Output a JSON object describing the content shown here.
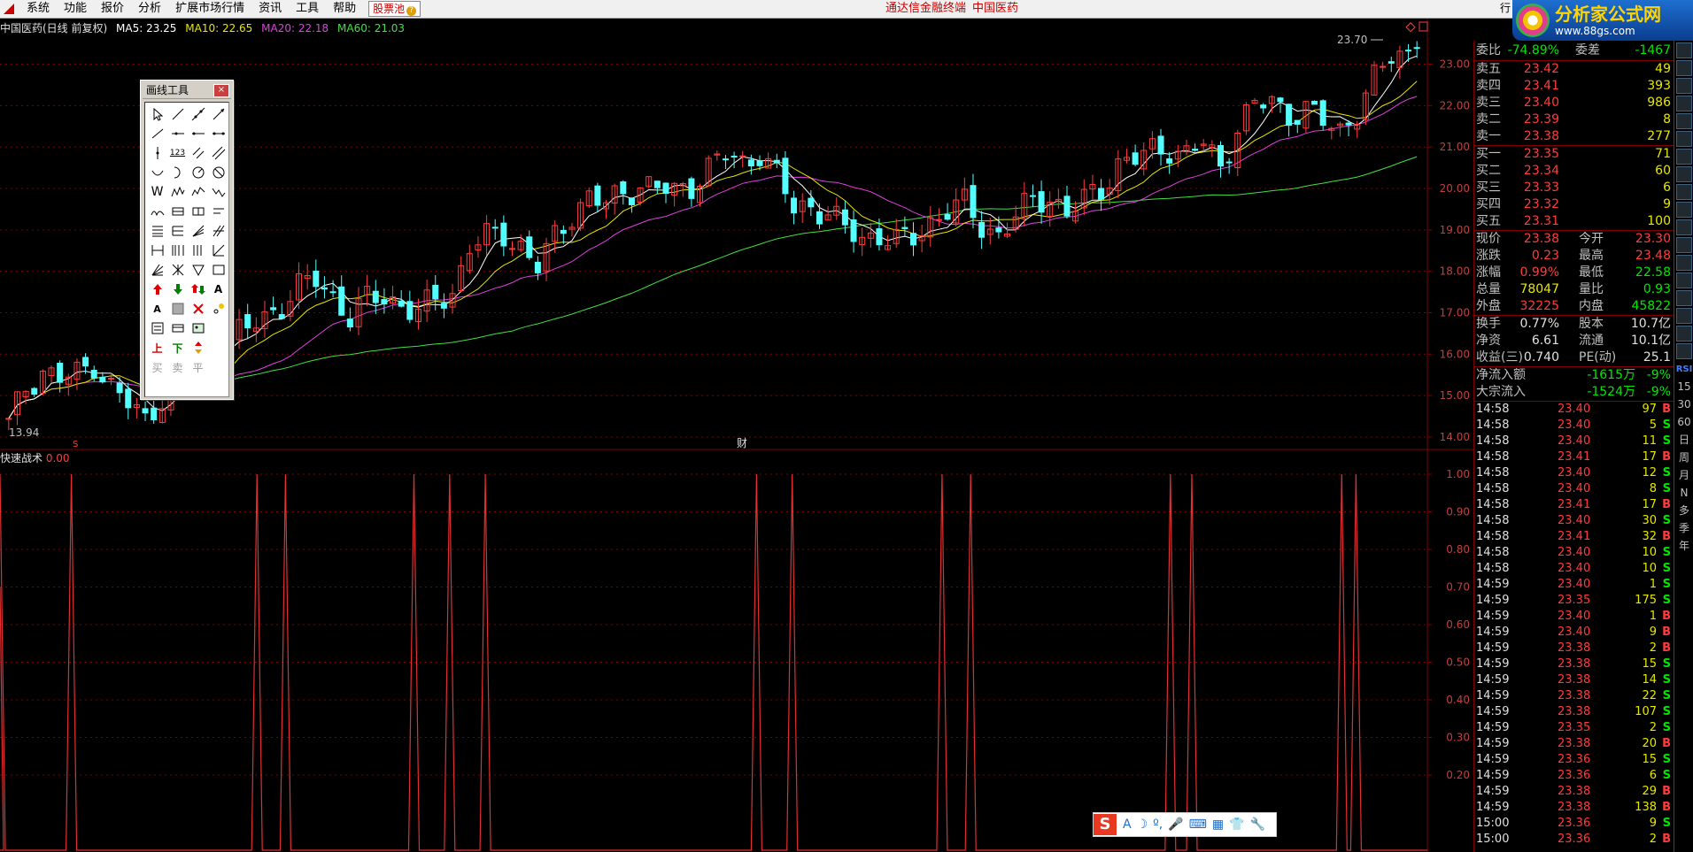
{
  "menu": {
    "items": [
      "系统",
      "功能",
      "报价",
      "分析",
      "扩展市场行情",
      "资讯",
      "工具",
      "帮助"
    ],
    "pool": "股票池",
    "app_title": "通达信金融终端",
    "stock_title": "中国医药"
  },
  "brand": {
    "name": "分析家公式网",
    "url": "www.88gs.com",
    "left_tab": "行"
  },
  "main_chart": {
    "title": "中国医药(日线 前复权)",
    "ma5": "MA5: 23.25",
    "ma10": "MA10: 22.65",
    "ma20": "MA20: 22.18",
    "ma60": "MA60: 21.03",
    "high_label": "23.70",
    "low_label": "13.94",
    "marker_s": "S",
    "marker_cai": "财"
  },
  "indicator": {
    "name": "快速战术",
    "value": "0.00"
  },
  "toolbox": {
    "title": "画线工具",
    "close": "×",
    "text_tools": [
      "123",
      "W",
      "A",
      "A",
      "上",
      "下",
      "买",
      "卖",
      "平"
    ]
  },
  "colors": {
    "up": "#ff3c3c",
    "down": "#54ffff",
    "ma5": "#ffffff",
    "ma10": "#e6e600",
    "ma20": "#e040e0",
    "ma60": "#40e040",
    "grid": "#800000"
  },
  "quote": {
    "weibi": {
      "label": "委比",
      "value": "-74.89%",
      "label2": "委差",
      "value2": "-1467"
    },
    "sell": [
      {
        "label": "卖五",
        "price": "23.42",
        "vol": "49"
      },
      {
        "label": "卖四",
        "price": "23.41",
        "vol": "393"
      },
      {
        "label": "卖三",
        "price": "23.40",
        "vol": "986"
      },
      {
        "label": "卖二",
        "price": "23.39",
        "vol": "8"
      },
      {
        "label": "卖一",
        "price": "23.38",
        "vol": "277"
      }
    ],
    "buy": [
      {
        "label": "买一",
        "price": "23.35",
        "vol": "71"
      },
      {
        "label": "买二",
        "price": "23.34",
        "vol": "60"
      },
      {
        "label": "买三",
        "price": "23.33",
        "vol": "6"
      },
      {
        "label": "买四",
        "price": "23.32",
        "vol": "9"
      },
      {
        "label": "买五",
        "price": "23.31",
        "vol": "100"
      }
    ],
    "stats": [
      {
        "l1": "现价",
        "v1": "23.38",
        "c1": "red",
        "l2": "今开",
        "v2": "23.30",
        "c2": "red"
      },
      {
        "l1": "涨跌",
        "v1": "0.23",
        "c1": "red",
        "l2": "最高",
        "v2": "23.48",
        "c2": "red"
      },
      {
        "l1": "涨幅",
        "v1": "0.99%",
        "c1": "red",
        "l2": "最低",
        "v2": "22.58",
        "c2": "green"
      },
      {
        "l1": "总量",
        "v1": "78047",
        "c1": "yellow",
        "l2": "量比",
        "v2": "0.93",
        "c2": "green"
      },
      {
        "l1": "外盘",
        "v1": "32225",
        "c1": "red",
        "l2": "内盘",
        "v2": "45822",
        "c2": "green"
      }
    ],
    "stats2": [
      {
        "l1": "换手",
        "v1": "0.77%",
        "c1": "white",
        "l2": "股本",
        "v2": "10.7亿",
        "c2": "white"
      },
      {
        "l1": "净资",
        "v1": "6.61",
        "c1": "white",
        "l2": "流通",
        "v2": "10.1亿",
        "c2": "white"
      },
      {
        "l1": "收益(三)",
        "v1": "0.740",
        "c1": "white",
        "l2": "PE(动)",
        "v2": "25.1",
        "c2": "white"
      }
    ],
    "flow": [
      {
        "label": "净流入额",
        "value": "-1615万",
        "pct": "-9%"
      },
      {
        "label": "大宗流入",
        "value": "-1524万",
        "pct": "-9%"
      }
    ],
    "ticks": [
      {
        "t": "14:58",
        "p": "23.40",
        "pc": "red",
        "v": "97",
        "bs": "B"
      },
      {
        "t": "14:58",
        "p": "23.40",
        "pc": "red",
        "v": "5",
        "bs": "S"
      },
      {
        "t": "14:58",
        "p": "23.40",
        "pc": "red",
        "v": "11",
        "bs": "S"
      },
      {
        "t": "14:58",
        "p": "23.41",
        "pc": "red",
        "v": "17",
        "bs": "B"
      },
      {
        "t": "14:58",
        "p": "23.40",
        "pc": "red",
        "v": "12",
        "bs": "S"
      },
      {
        "t": "14:58",
        "p": "23.40",
        "pc": "red",
        "v": "8",
        "bs": "S"
      },
      {
        "t": "14:58",
        "p": "23.41",
        "pc": "red",
        "v": "17",
        "bs": "B"
      },
      {
        "t": "14:58",
        "p": "23.40",
        "pc": "red",
        "v": "30",
        "bs": "S"
      },
      {
        "t": "14:58",
        "p": "23.41",
        "pc": "red",
        "v": "32",
        "bs": "B"
      },
      {
        "t": "14:58",
        "p": "23.40",
        "pc": "red",
        "v": "10",
        "bs": "S"
      },
      {
        "t": "14:58",
        "p": "23.40",
        "pc": "red",
        "v": "10",
        "bs": "S"
      },
      {
        "t": "14:59",
        "p": "23.40",
        "pc": "red",
        "v": "1",
        "bs": "S"
      },
      {
        "t": "14:59",
        "p": "23.35",
        "pc": "red",
        "v": "175",
        "bs": "S"
      },
      {
        "t": "14:59",
        "p": "23.40",
        "pc": "red",
        "v": "1",
        "bs": "B"
      },
      {
        "t": "14:59",
        "p": "23.40",
        "pc": "red",
        "v": "9",
        "bs": "B"
      },
      {
        "t": "14:59",
        "p": "23.38",
        "pc": "red",
        "v": "2",
        "bs": "B"
      },
      {
        "t": "14:59",
        "p": "23.38",
        "pc": "red",
        "v": "15",
        "bs": "S"
      },
      {
        "t": "14:59",
        "p": "23.38",
        "pc": "red",
        "v": "14",
        "bs": "S"
      },
      {
        "t": "14:59",
        "p": "23.38",
        "pc": "red",
        "v": "22",
        "bs": "S"
      },
      {
        "t": "14:59",
        "p": "23.38",
        "pc": "red",
        "v": "107",
        "bs": "S"
      },
      {
        "t": "14:59",
        "p": "23.35",
        "pc": "red",
        "v": "2",
        "bs": "S"
      },
      {
        "t": "14:59",
        "p": "23.38",
        "pc": "red",
        "v": "20",
        "bs": "B"
      },
      {
        "t": "14:59",
        "p": "23.36",
        "pc": "red",
        "v": "15",
        "bs": "S"
      },
      {
        "t": "14:59",
        "p": "23.36",
        "pc": "red",
        "v": "6",
        "bs": "S"
      },
      {
        "t": "14:59",
        "p": "23.38",
        "pc": "red",
        "v": "29",
        "bs": "B"
      },
      {
        "t": "14:59",
        "p": "23.38",
        "pc": "red",
        "v": "138",
        "bs": "B"
      },
      {
        "t": "15:00",
        "p": "23.36",
        "pc": "red",
        "v": "9",
        "bs": "S"
      },
      {
        "t": "15:00",
        "p": "23.36",
        "pc": "red",
        "v": "2",
        "bs": "B"
      }
    ]
  },
  "sidebar": {
    "labels": [
      "RSI",
      "15",
      "30",
      "60",
      "日",
      "周",
      "月",
      "N",
      "多",
      "季",
      "年"
    ]
  },
  "ime": {
    "logo": "S",
    "mode": "A"
  },
  "chart_data": [
    {
      "type": "candlestick",
      "title": "中国医药(日线 前复权)",
      "y_ticks": [
        "23.00",
        "22.00",
        "21.00",
        "20.00",
        "19.00",
        "18.00",
        "17.00",
        "16.00",
        "15.00",
        "14.00"
      ],
      "ylim": [
        13.7,
        24.1
      ],
      "high": 23.7,
      "low": 13.94,
      "ma_last": {
        "MA5": 23.25,
        "MA10": 22.65,
        "MA20": 22.18,
        "MA60": 21.03
      },
      "close_path": [
        14.3,
        15.2,
        15.6,
        15.4,
        15.5,
        15.8,
        15.2,
        14.8,
        14.4,
        15.0,
        15.6,
        15.9,
        16.2,
        16.4,
        16.6,
        16.9,
        17.2,
        17.6,
        17.8,
        17.4,
        16.9,
        17.3,
        17.4,
        17.2,
        17.0,
        17.3,
        17.5,
        18.6,
        18.8,
        18.9,
        18.6,
        18.1,
        18.8,
        19.4,
        19.8,
        19.6,
        19.9,
        20.1,
        20.0,
        19.9,
        20.1,
        20.5,
        20.8,
        20.6,
        20.9,
        20.3,
        19.5,
        19.6,
        19.4,
        19.0,
        18.8,
        18.9,
        18.7,
        18.8,
        19.2,
        19.5,
        19.6,
        19.1,
        18.9,
        19.3,
        19.7,
        19.8,
        19.4,
        19.7,
        20.0,
        20.6,
        20.7,
        20.9,
        21.0,
        20.8,
        21.1,
        20.5,
        21.5,
        22.0,
        22.1,
        21.8,
        21.9,
        21.6,
        21.4,
        21.9,
        22.6,
        23.2,
        23.3
      ]
    },
    {
      "type": "line",
      "title": "快速战术",
      "y_ticks": [
        "1.00",
        "0.90",
        "0.80",
        "0.70",
        "0.60",
        "0.50",
        "0.40",
        "0.30",
        "0.20"
      ],
      "ylim": [
        0,
        1
      ],
      "value": 0.0,
      "spikes": [
        0.0,
        0.05,
        0.18,
        0.2,
        0.29,
        0.315,
        0.34,
        0.53,
        0.555,
        0.66,
        0.68,
        0.82,
        0.835,
        0.94,
        0.95
      ]
    }
  ]
}
